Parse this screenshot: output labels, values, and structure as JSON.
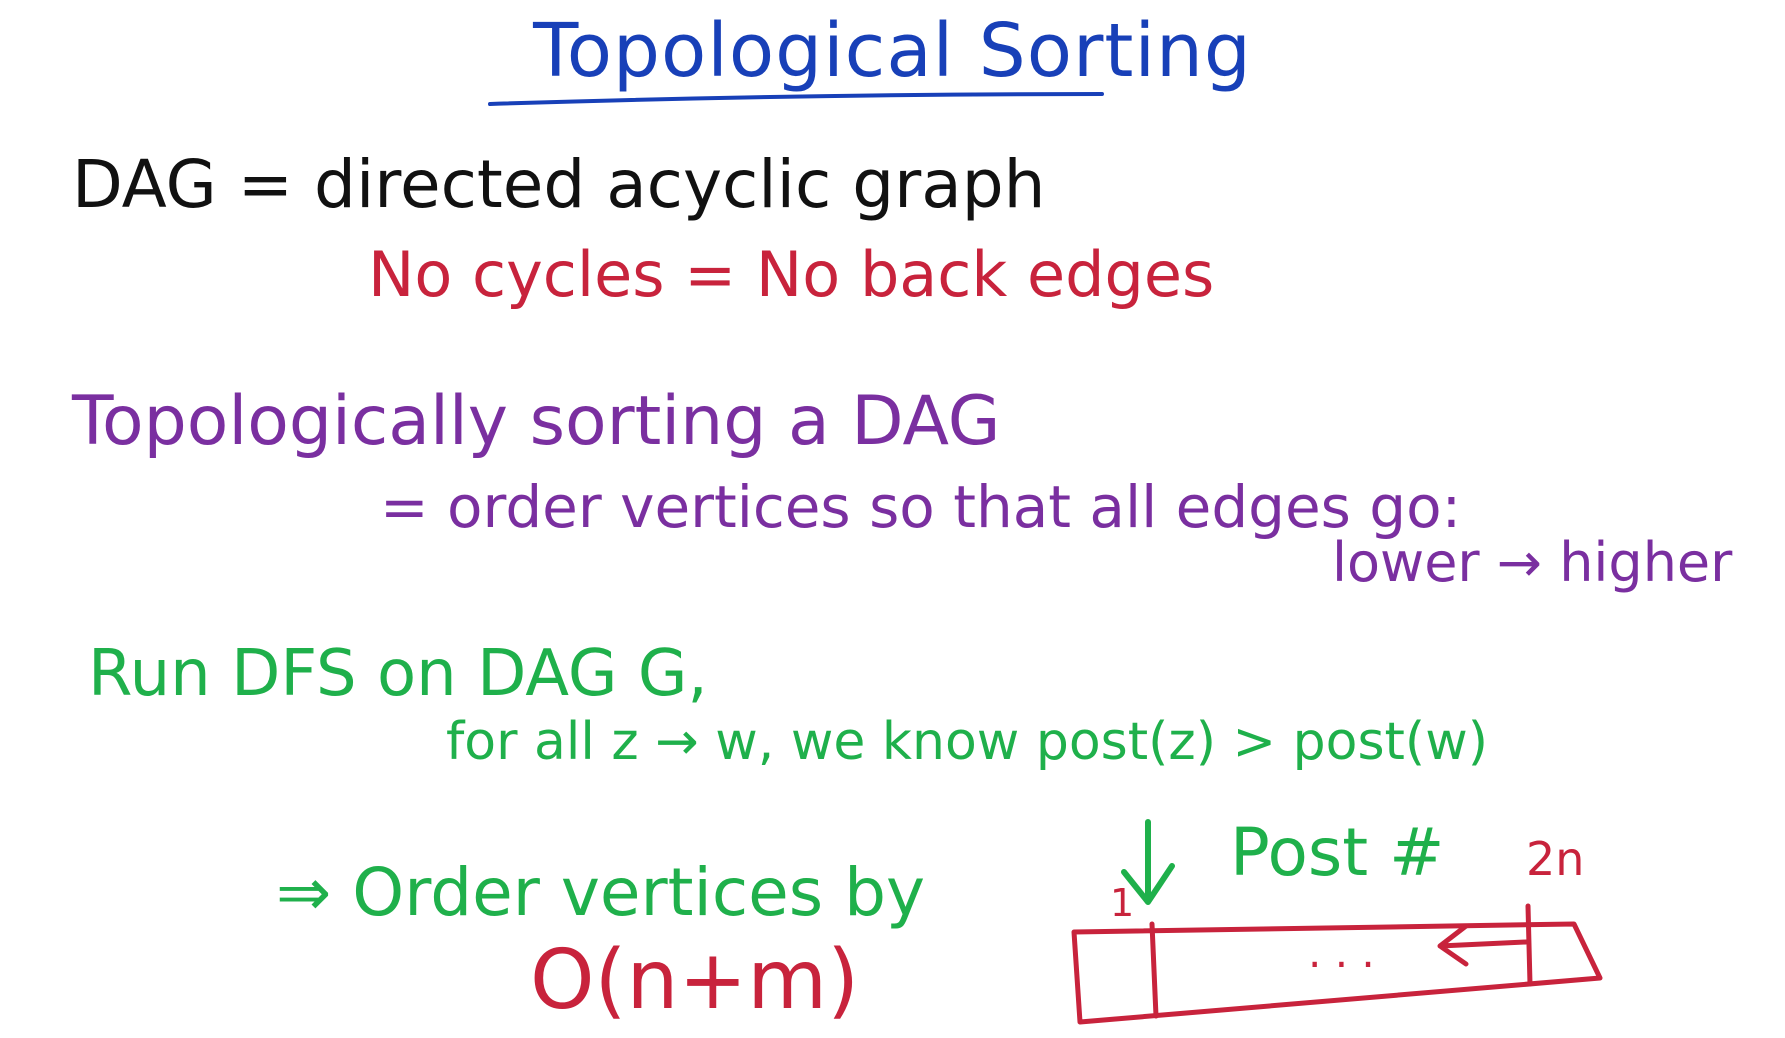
{
  "colors": {
    "title": "#1840b8",
    "black": "#111111",
    "red": "#c8233c",
    "purple": "#7a2fa0",
    "green": "#1fb04b"
  },
  "title": "Topological Sorting",
  "dag_line": "DAG = directed acyclic graph",
  "no_cycles_line": "No cycles = No back edges",
  "topo_line": "Topologically sorting a DAG",
  "order_line": "= order vertices so that all edges go:",
  "lower_higher": "lower → higher",
  "run_dfs_line": "Run DFS on DAG G,",
  "for_all_line": "for all z → w, we know post(z) > post(w)",
  "order_by_line": "⇒ Order vertices by",
  "post_label": "Post #",
  "complexity": "O(n+m)",
  "array": {
    "left_index": "1",
    "right_index": "2n",
    "ellipsis": ". . ."
  }
}
